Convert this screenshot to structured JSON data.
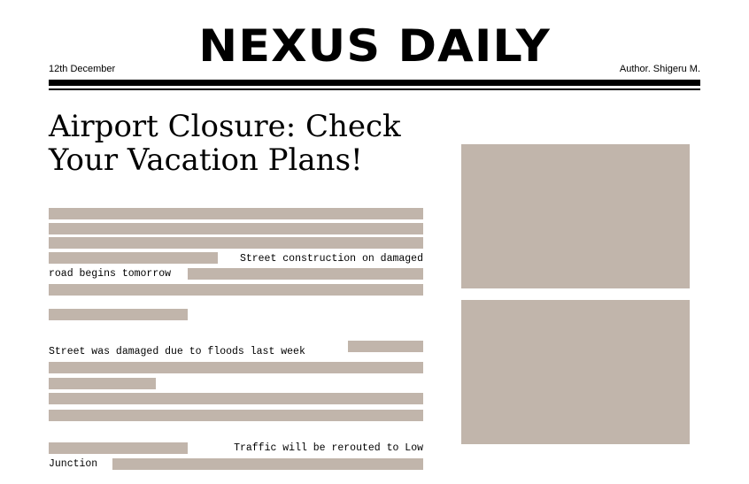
{
  "masthead": {
    "title": "NEXUS DAILY",
    "date": "12th December",
    "author": "Author. Shigeru M."
  },
  "article": {
    "headline_line1": "Airport Closure: Check",
    "headline_line2": "Your Vacation Plans!",
    "paragraph1_line4": "Street construction on damaged",
    "paragraph1_line5": "road begins tomorrow",
    "paragraph2_line1": "Street was damaged due to floods last week",
    "paragraph3_line1": "Traffic will be rerouted to Low",
    "paragraph3_line2": "Junction"
  },
  "colors": {
    "placeholder": "#c1b5ab",
    "ink": "#000000",
    "paper": "#ffffff"
  }
}
